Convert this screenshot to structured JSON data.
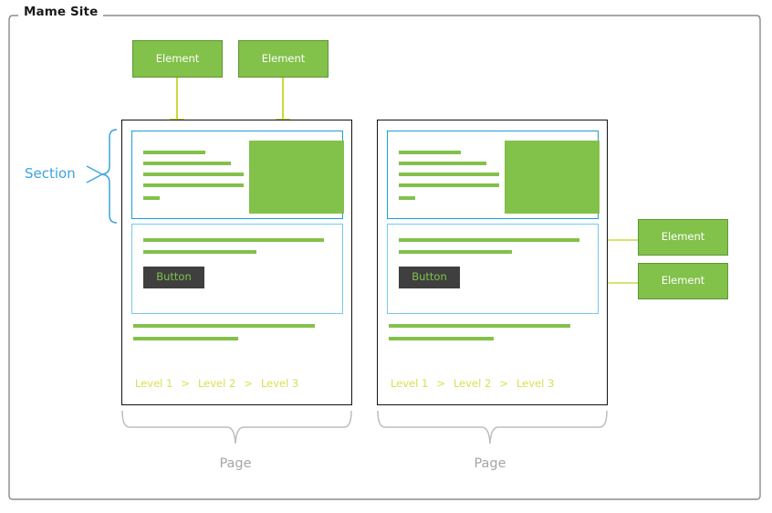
{
  "diagram": {
    "title": "Mame Site",
    "frame_color": "#8c8c8c",
    "accent_green": "#82c14a",
    "accent_blue": "#1e9cd7",
    "accent_blue_light": "#77c9ef",
    "arrow_color": "#cbd93f",
    "brace_gray": "#bdbdbd",
    "label_gray": "#a6a6a6",
    "button_bg": "#3f3f3f"
  },
  "callouts": {
    "top": [
      {
        "label": "Element"
      },
      {
        "label": "Element"
      }
    ],
    "right": [
      {
        "label": "Element"
      },
      {
        "label": "Element"
      }
    ]
  },
  "labels": {
    "section": "Section",
    "page_left": "Page",
    "page_right": "Page"
  },
  "pages": [
    {
      "name": "page-left",
      "button_label": "Button",
      "breadcrumb": {
        "level1": "Level 1",
        "sep1": ">",
        "level2": "Level 2",
        "sep2": ">",
        "level3": "Level 3"
      },
      "header_lines": [
        68,
        96,
        110,
        110,
        18
      ],
      "body_lines": [
        198,
        124
      ],
      "footer_lines": [
        199,
        115
      ]
    },
    {
      "name": "page-right",
      "button_label": "Button",
      "breadcrumb": {
        "level1": "Level 1",
        "sep1": ">",
        "level2": "Level 2",
        "sep2": ">",
        "level3": "Level 3"
      },
      "header_lines": [
        68,
        96,
        110,
        110,
        18
      ],
      "body_lines": [
        198,
        124
      ],
      "footer_lines": [
        199,
        115
      ]
    }
  ]
}
